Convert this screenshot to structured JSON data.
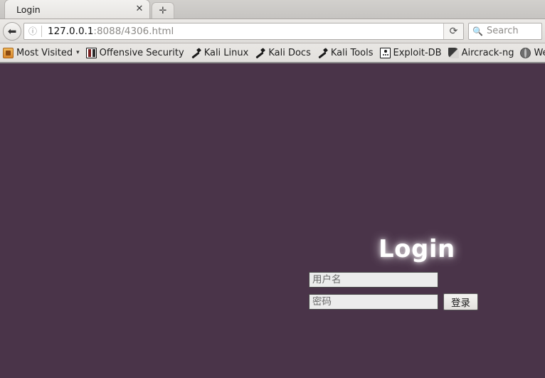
{
  "browser": {
    "tab": {
      "title": "Login",
      "close_icon": "close-icon",
      "newtab_icon": "✛"
    },
    "toolbar": {
      "back_icon": "◄",
      "info_icon": "ⓘ",
      "reload_icon": "⟳",
      "url_host": "127.0.0.1",
      "url_path": ":8088/4306.html",
      "search_icon": "⌕",
      "search_placeholder": "Search"
    },
    "bookmarks": [
      {
        "label": "Most Visited",
        "icon": "folder-icon",
        "caret": "▾"
      },
      {
        "label": "Offensive Security",
        "icon": "dragon-icon",
        "caret": ""
      },
      {
        "label": "Kali Linux",
        "icon": "wrench-icon",
        "caret": ""
      },
      {
        "label": "Kali Docs",
        "icon": "wrench-icon",
        "caret": ""
      },
      {
        "label": "Kali Tools",
        "icon": "wrench-icon",
        "caret": ""
      },
      {
        "label": "Exploit-DB",
        "icon": "exploit-db-icon",
        "caret": ""
      },
      {
        "label": "Aircrack-ng",
        "icon": "feather-icon",
        "caret": ""
      },
      {
        "label": "We",
        "icon": "globe-icon",
        "caret": ""
      }
    ]
  },
  "page": {
    "background_color": "#4a3449",
    "login": {
      "title": "Login",
      "username_placeholder": "用户名",
      "username_value": "",
      "password_placeholder": "密码",
      "password_value": "",
      "submit_label": "登录"
    }
  }
}
